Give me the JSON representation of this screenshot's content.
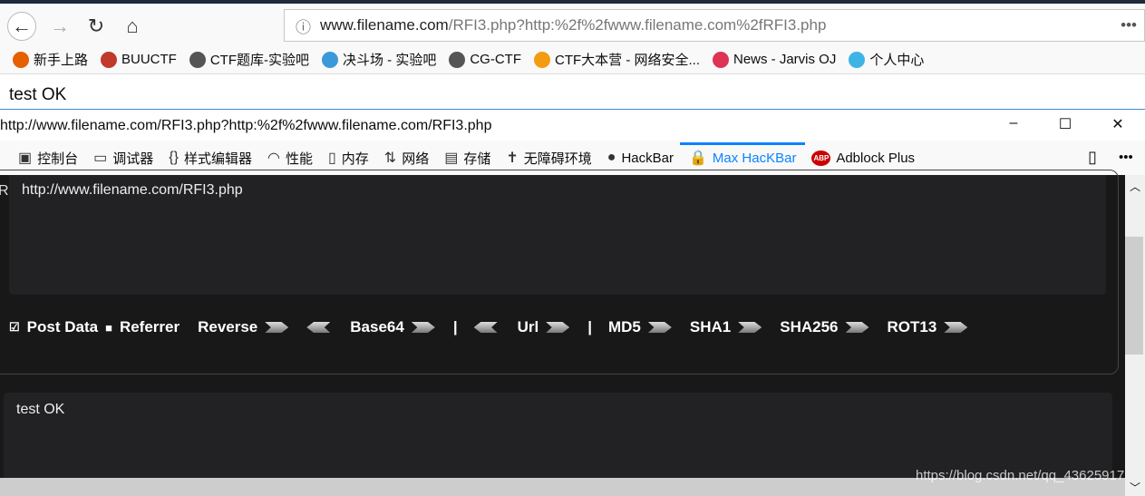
{
  "browser": {
    "url_host": "www.filename.com",
    "url_rest": "/RFI3.php?http:%2f%2fwww.filename.com%2fRFI3.php",
    "menu_icon": "•••"
  },
  "bookmarks": [
    {
      "label": "新手上路",
      "color": "#e66000"
    },
    {
      "label": "BUUCTF",
      "color": "#c0392b"
    },
    {
      "label": "CTF题库-实验吧",
      "color": "#555"
    },
    {
      "label": "决斗场 - 实验吧",
      "color": "#3a9ad9"
    },
    {
      "label": "CG-CTF",
      "color": "#555"
    },
    {
      "label": "CTF大本营 - 网络安全...",
      "color": "#f39c12"
    },
    {
      "label": "News - Jarvis OJ",
      "color": "#d35"
    },
    {
      "label": "个人中心",
      "color": "#3cb4e6"
    }
  ],
  "page": {
    "text": "test OK"
  },
  "devtools": {
    "title": "http://www.filename.com/RFI3.php?http:%2f%2fwww.filename.com/RFI3.php",
    "tabs": [
      {
        "label": "控制台",
        "icon": "▣"
      },
      {
        "label": "调试器",
        "icon": "▭"
      },
      {
        "label": "样式编辑器",
        "icon": "{}"
      },
      {
        "label": "性能",
        "icon": "◠"
      },
      {
        "label": "内存",
        "icon": "▯"
      },
      {
        "label": "网络",
        "icon": "⇅"
      },
      {
        "label": "存储",
        "icon": "▤"
      },
      {
        "label": "无障碍环境",
        "icon": "✝"
      },
      {
        "label": "HackBar",
        "icon": "●"
      },
      {
        "label": "Max HacKBar",
        "icon": "🔒"
      },
      {
        "label": "Adblock Plus",
        "icon": "ABP"
      }
    ],
    "active_tab": "Max HacKBar"
  },
  "hackbar": {
    "url_value": "http://www.filename.com/RFI3.php",
    "post_data_label": "Post Data",
    "post_data_checked": true,
    "referrer_label": "Referrer",
    "referrer_checked": false,
    "buttons": [
      "Reverse",
      "Base64",
      "Url",
      "MD5",
      "SHA1",
      "SHA256",
      "ROT13"
    ],
    "separator": "|",
    "result": "test OK"
  },
  "watermark": "https://blog.csdn.net/qq_43625917"
}
